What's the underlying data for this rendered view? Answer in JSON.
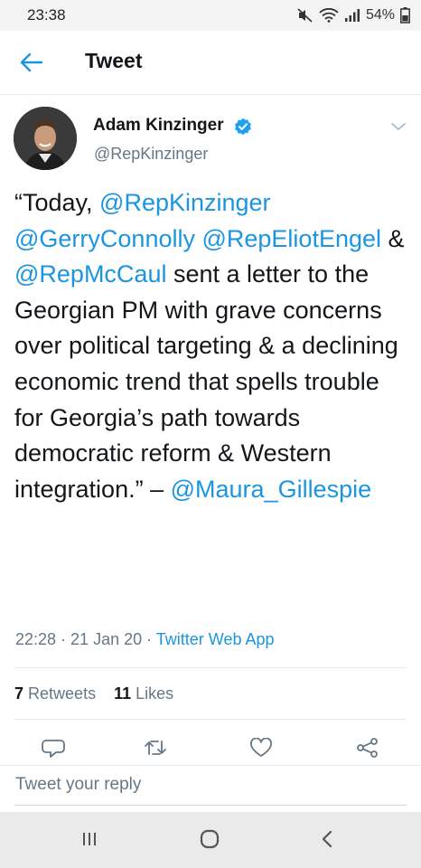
{
  "status_bar": {
    "time": "23:38",
    "battery": "54%",
    "icons": [
      "mute-icon",
      "wifi-icon",
      "signal-icon",
      "battery-icon"
    ]
  },
  "header": {
    "title": "Tweet",
    "back_icon": "arrow-left-icon"
  },
  "tweet": {
    "author_name": "Adam Kinzinger",
    "handle": "@RepKinzinger",
    "verified": true,
    "text": [
      {
        "t": "“Today, ",
        "mention": false
      },
      {
        "t": "@RepKinzinger",
        "mention": true
      },
      {
        "t": " ",
        "mention": false
      },
      {
        "t": "@GerryConnolly",
        "mention": true
      },
      {
        "t": " ",
        "mention": false
      },
      {
        "t": "@RepEliotEngel",
        "mention": true
      },
      {
        "t": " & ",
        "mention": false
      },
      {
        "t": "@RepMcCaul",
        "mention": true
      },
      {
        "t": " sent a letter to the Georgian PM with grave concerns over political targeting & a declining economic trend that spells trouble for Georgia’s path towards democratic reform & Western integration.” – ",
        "mention": false
      },
      {
        "t": "@Maura_Gillespie",
        "mention": true
      }
    ],
    "time": "22:28",
    "date": "21 Jan 20",
    "source": "Twitter Web App",
    "retweets_count": "7",
    "retweets_label": "Retweets",
    "likes_count": "11",
    "likes_label": "Likes"
  },
  "actions": [
    "reply-icon",
    "retweet-icon",
    "like-icon",
    "share-icon"
  ],
  "reply": {
    "placeholder": "Tweet your reply"
  },
  "colors": {
    "accent": "#1b95e0",
    "text": "#14171a",
    "secondary": "#657786",
    "divider": "#e6ecf0"
  }
}
